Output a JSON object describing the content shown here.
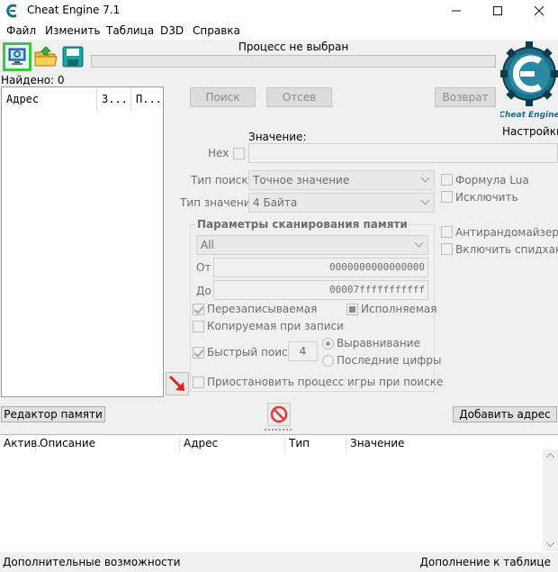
{
  "window": {
    "title": "Cheat Engine 7.1"
  },
  "menu": [
    "Файл",
    "Изменить",
    "Таблица",
    "D3D",
    "Справка"
  ],
  "process": {
    "label": "Процесс не выбран"
  },
  "logo": {
    "caption": "Cheat Engine",
    "settings_label": "Настройки"
  },
  "found": "Найдено: 0",
  "results": {
    "columns": [
      "Адрес",
      "З...",
      "П..."
    ]
  },
  "scan_buttons": {
    "first": "Поиск",
    "next": "Отсев",
    "undo": "Возврат"
  },
  "value": {
    "label": "Значение:",
    "hex_label": "Hex",
    "input_value": ""
  },
  "scan_type": {
    "label": "Тип поиска",
    "selected": "Точное значение"
  },
  "value_type": {
    "label": "Тип значения",
    "selected": "4 Байта"
  },
  "options": {
    "lua_formula": "Формула Lua",
    "exclude": "Исключить",
    "unrandomizer": "Антирандомайзер",
    "speedhack": "Включить спидхак"
  },
  "memory_scan": {
    "title": "Параметры сканирования памяти",
    "region": "All",
    "from_label": "От",
    "from_value": "0000000000000000",
    "to_label": "До",
    "to_value": "00007fffffffffff",
    "writable": "Перезаписываемая",
    "executable": "Исполняемая",
    "copy_on_write": "Копируемая при записи",
    "fast_scan": "Быстрый поиск",
    "fast_scan_value": "4",
    "alignment": "Выравнивание",
    "last_digits": "Последние цифры",
    "pause_game": "Приостановить процесс игры при поиске"
  },
  "memory_view_button": "Редактор памяти",
  "add_address_button": "Добавить адрес",
  "address_table": {
    "columns": [
      "Актив.",
      "Описание",
      "Адрес",
      "Тип",
      "Значение"
    ]
  },
  "status": {
    "left": "Дополнительные возможности",
    "right": "Дополнение к таблице"
  },
  "colors": {
    "highlight": "#3cc93c",
    "logo": "#1b6f86",
    "stop": "#e23b3b"
  }
}
